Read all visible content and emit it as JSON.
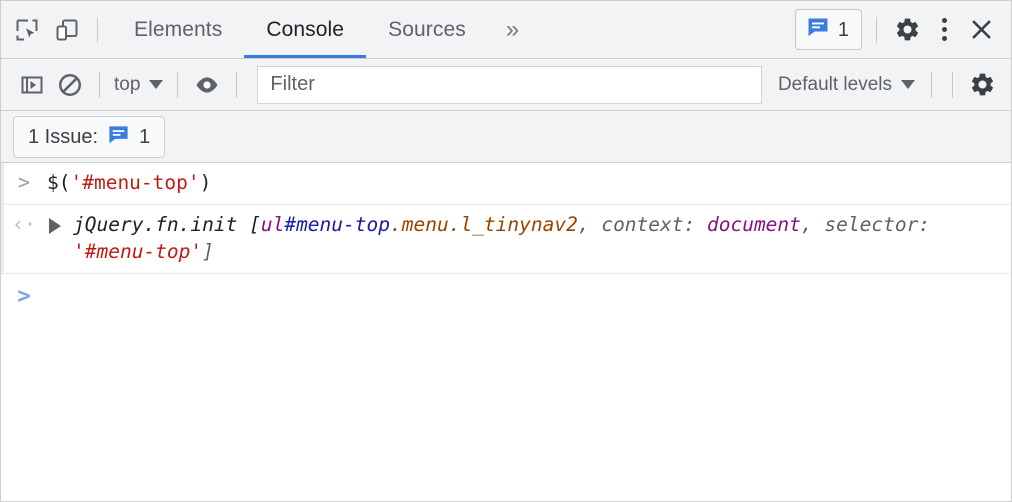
{
  "toolbar": {
    "inspect_icon": "inspect-element-icon",
    "device_icon": "device-toolbar-icon",
    "tabs": [
      {
        "label": "Elements",
        "active": false
      },
      {
        "label": "Console",
        "active": true
      },
      {
        "label": "Sources",
        "active": false
      }
    ],
    "more_tabs_label": "»",
    "issues_badge": {
      "icon": "issues-message-icon",
      "count": "1"
    },
    "settings_icon": "gear-icon",
    "menu_icon": "kebab-menu-icon",
    "close_icon": "close-icon",
    "accent_color": "#3b78e7",
    "badge_color": "#3b7ddd"
  },
  "console_toolbar": {
    "sidebar_icon": "console-sidebar-icon",
    "clear_icon": "clear-console-icon",
    "context_value": "top",
    "eye_icon": "live-expression-eye-icon",
    "filter_placeholder": "Filter",
    "filter_value": "",
    "levels_value": "Default levels",
    "settings_icon": "gear-icon"
  },
  "issue_bar": {
    "label": "1 Issue:",
    "icon": "issues-message-icon",
    "count": "1"
  },
  "console": {
    "messages": [
      {
        "type": "input",
        "marker": ">",
        "tokens": [
          {
            "text": "$(",
            "cls": "tok-plain"
          },
          {
            "text": "'#menu-top'",
            "cls": "tok-str"
          },
          {
            "text": ")",
            "cls": "tok-plain"
          }
        ]
      },
      {
        "type": "result",
        "marker": "‹·",
        "expanded": false,
        "tokens": [
          {
            "text": "jQuery.fn.init [",
            "cls": "tok-plain"
          },
          {
            "text": "ul",
            "cls": "tok-tag"
          },
          {
            "text": "#menu-top",
            "cls": "tok-id"
          },
          {
            "text": ".menu.l_tinynav2",
            "cls": "tok-class"
          },
          {
            "text": ", context: ",
            "cls": "tok-gray"
          },
          {
            "text": "document",
            "cls": "tok-kw"
          },
          {
            "text": ", selector: ",
            "cls": "tok-gray"
          },
          {
            "text": "'#menu-top'",
            "cls": "tok-str"
          },
          {
            "text": "]",
            "cls": "tok-gray"
          }
        ]
      }
    ],
    "prompt_marker": ">"
  }
}
